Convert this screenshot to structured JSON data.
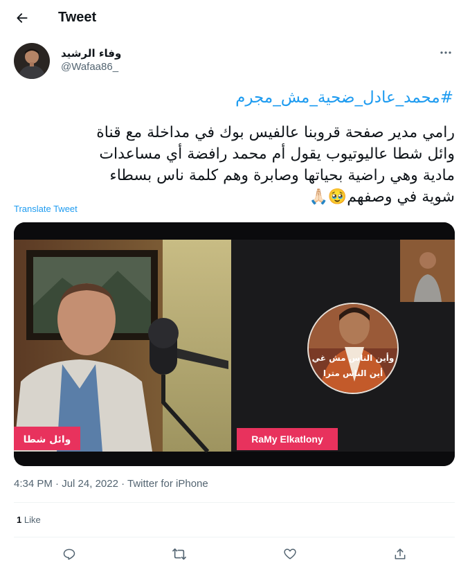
{
  "header": {
    "title": "Tweet",
    "back_icon": "arrow-left-icon"
  },
  "author": {
    "name": "وفاء الرشيد",
    "handle": "@Wafaa86_"
  },
  "tweet": {
    "hashtag": "#محمد_عادل_ضحية_مش_مجرم",
    "lines": [
      "رامي مدير صفحة قروبنا عالفيس بوك في مداخلة مع قناة",
      "وائل شطا عاليوتيوب يقول أم محمد رافضة أي مساعدات",
      "مادية وهي راضية بحياتها وصابرة وهم كلمة ناس بسطاء",
      "شوية في وصفهم🥹🙏🏻"
    ],
    "translate_label": "Translate Tweet"
  },
  "media": {
    "left_name_tag": "وائل شطا",
    "right_name_tag": "RaMy Elkatlony",
    "circle_caption_1": "وأين الناس مش غي",
    "circle_caption_2": "أين الناس مترا"
  },
  "meta": {
    "time": "4:34 PM",
    "date": "Jul 24, 2022",
    "source": "Twitter for iPhone",
    "separator": " · "
  },
  "stats": {
    "like_count": "1",
    "like_label": " Like"
  },
  "colors": {
    "accent": "#1d9bf0",
    "secondary_text": "#536471",
    "name_tag": "#e8325d"
  }
}
